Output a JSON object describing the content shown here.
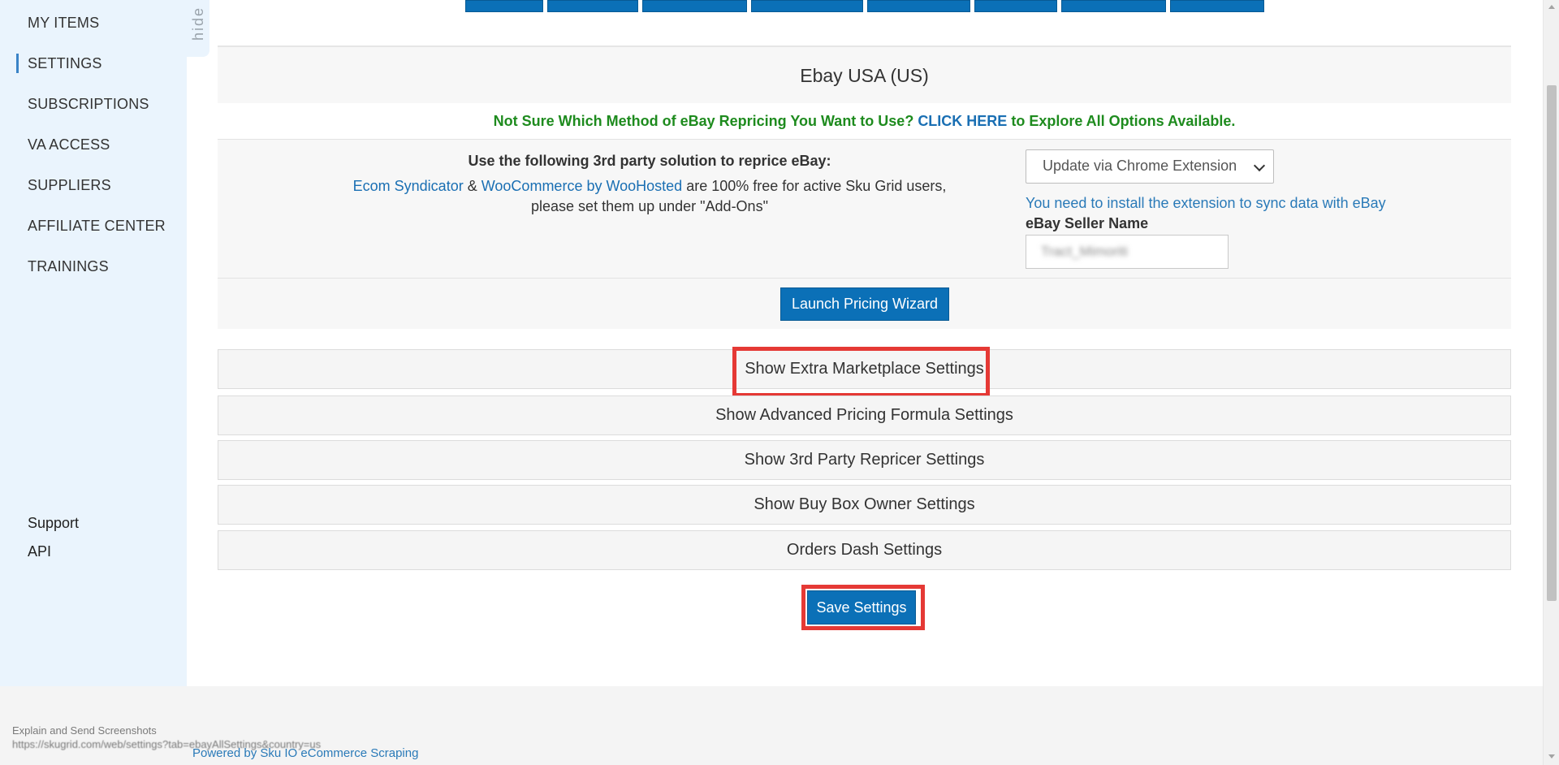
{
  "sidebar": {
    "hide_label": "hide",
    "items": [
      {
        "label": "MY ITEMS"
      },
      {
        "label": "SETTINGS",
        "active": true
      },
      {
        "label": "SUBSCRIPTIONS"
      },
      {
        "label": "VA ACCESS"
      },
      {
        "label": "SUPPLIERS"
      },
      {
        "label": "AFFILIATE CENTER"
      },
      {
        "label": "TRAININGS"
      }
    ],
    "support_label": "Support",
    "api_label": "API"
  },
  "marketplace": {
    "title": "Ebay USA (US)",
    "notice_before": "Not Sure Which Method of eBay Repricing You Want to Use?",
    "notice_link": "CLICK HERE",
    "notice_after": "to Explore All Options Available.",
    "solution_title": "Use the following 3rd party solution to reprice eBay:",
    "link_ecom": "Ecom Syndicator",
    "amp": "&",
    "link_woo": "WooCommerce by WooHosted",
    "solution_text_1": "are 100% free for active Sku Grid users,",
    "solution_text_2": "please set them up under \"Add-Ons\"",
    "update_method": "Update via Chrome Extension",
    "extension_note": "You need to install the extension to sync data with eBay",
    "seller_name_label": "eBay Seller Name",
    "seller_name_value": "Tract_Mimoriti",
    "wizard_button": "Launch Pricing Wizard"
  },
  "accordions": [
    {
      "label": "Show Extra Marketplace Settings"
    },
    {
      "label": "Show Advanced Pricing Formula Settings"
    },
    {
      "label": "Show 3rd Party Repricer Settings"
    },
    {
      "label": "Show Buy Box Owner Settings"
    },
    {
      "label": "Orders Dash Settings"
    }
  ],
  "save_button": "Save Settings",
  "footer": {
    "powered_by": "Powered by Sku IO eCommerce Scraping",
    "tooltip_title": "Explain and Send Screenshots",
    "tooltip_url": "https://skugrid.com/web/settings?tab=ebayAllSettings&country=us"
  },
  "colors": {
    "accent": "#0b70b7",
    "notice_green": "#1e8b1e",
    "link_blue": "#1a6fb3",
    "highlight_red": "#e53935",
    "sidebar_bg": "#eaf4fd"
  }
}
